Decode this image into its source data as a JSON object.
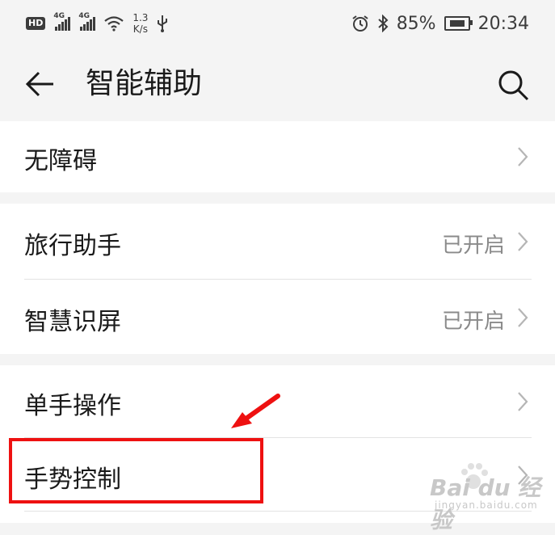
{
  "status_bar": {
    "hd": "HD",
    "net1": "4G",
    "net2": "4G",
    "speed_value": "1.3",
    "speed_unit": "K/s",
    "battery": "85%",
    "time": "20:34"
  },
  "header": {
    "title": "智能辅助"
  },
  "sections": [
    {
      "items": [
        {
          "label": "无障碍",
          "value": ""
        }
      ]
    },
    {
      "items": [
        {
          "label": "旅行助手",
          "value": "已开启"
        },
        {
          "label": "智慧识屏",
          "value": "已开启"
        }
      ]
    },
    {
      "items": [
        {
          "label": "单手操作",
          "value": ""
        },
        {
          "label": "手势控制",
          "value": ""
        }
      ]
    }
  ],
  "annotation": {
    "highlight_color": "#ee1111"
  },
  "watermark": {
    "brand": "Bai du 经验",
    "url": "jingyan.baidu.com"
  },
  "colors": {
    "background": "#f4f4f4",
    "card": "#ffffff",
    "secondary_text": "#8a8a8a"
  }
}
